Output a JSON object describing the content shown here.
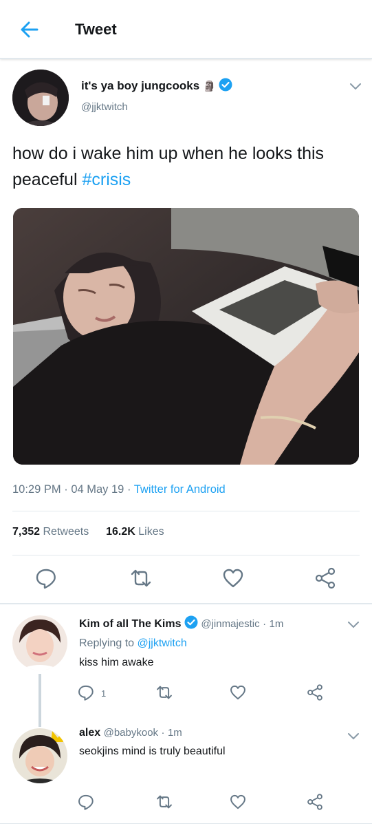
{
  "header": {
    "title": "Tweet"
  },
  "tweet": {
    "display_name": "it's ya boy jungcooks",
    "name_emoji": "🗿",
    "handle": "@jjktwitch",
    "text": "how do i wake him up when he looks this peaceful ",
    "hashtag": "#crisis",
    "time": "10:29 PM",
    "date": "04 May 19",
    "source": "Twitter for Android",
    "dot": "·",
    "retweets_count": "7,352",
    "retweets_label": "Retweets",
    "likes_count": "16.2K",
    "likes_label": "Likes"
  },
  "replies": [
    {
      "name": "Kim of all The Kims",
      "handle": "@jinmajestic",
      "time": "1m",
      "replying_prefix": "Replying to",
      "replying_to": "@jjktwitch",
      "text": "kiss him awake",
      "reply_count": "1"
    },
    {
      "name": "alex",
      "handle": "@babykook",
      "time": "1m",
      "text": "seokjins mind is truly beautiful"
    }
  ],
  "colors": {
    "accent": "#1da1f2",
    "text": "#14171a",
    "muted": "#657786",
    "border": "#e1e8ed"
  },
  "icons": [
    "back-arrow-icon",
    "verified-badge-icon",
    "chevron-down-icon",
    "reply-icon",
    "retweet-icon",
    "like-icon",
    "share-icon"
  ]
}
